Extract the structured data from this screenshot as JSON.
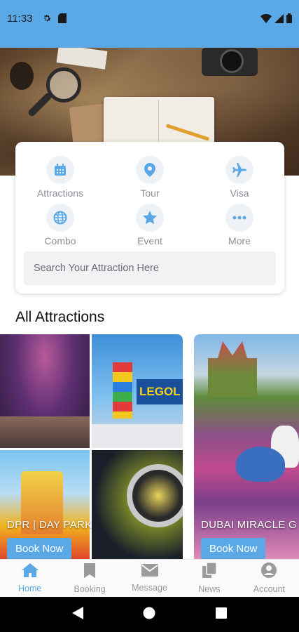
{
  "status_bar": {
    "time": "11:33",
    "background": "#5aa9e6"
  },
  "quick_categories": [
    {
      "label": "Attractions",
      "icon": "calendar-icon"
    },
    {
      "label": "Tour",
      "icon": "map-pin-icon"
    },
    {
      "label": "Visa",
      "icon": "airplane-icon"
    },
    {
      "label": "Combo",
      "icon": "globe-icon"
    },
    {
      "label": "Event",
      "icon": "star-icon"
    },
    {
      "label": "More",
      "icon": "more-dots-icon"
    }
  ],
  "search": {
    "placeholder": "Search Your Attraction Here"
  },
  "section": {
    "title": "All Attractions"
  },
  "attractions": [
    {
      "name": "DPR | DAY PARK",
      "book_label": "Book Now"
    },
    {
      "name": "DUBAI MIRACLE G",
      "book_label": "Book Now"
    }
  ],
  "bottom_nav": [
    {
      "label": "Home",
      "icon": "home-icon",
      "active": true
    },
    {
      "label": "Booking",
      "icon": "bookmark-icon",
      "active": false
    },
    {
      "label": "Message",
      "icon": "envelope-icon",
      "active": false
    },
    {
      "label": "News",
      "icon": "documents-icon",
      "active": false
    },
    {
      "label": "Account",
      "icon": "user-circle-icon",
      "active": false
    }
  ],
  "colors": {
    "accent": "#5aa9e6",
    "inactive": "#9a9a9a",
    "category_icon": "#5aa9e6"
  }
}
